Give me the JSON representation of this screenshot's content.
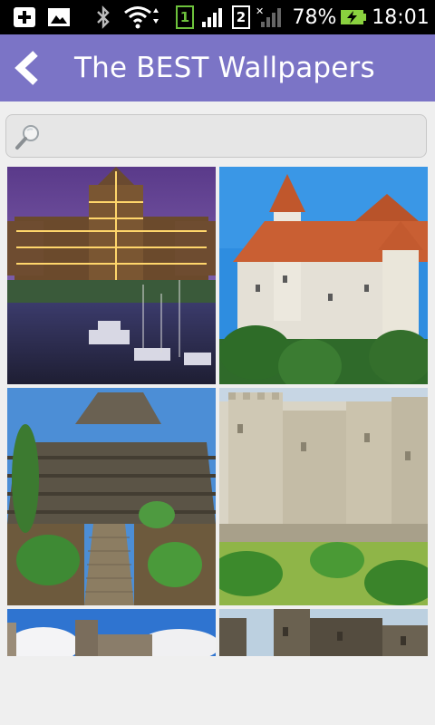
{
  "status_bar": {
    "sim1_label": "1",
    "sim2_label": "2",
    "battery_percent": "78%",
    "time": "18:01",
    "icons": [
      "add-notification-icon",
      "image-notification-icon",
      "bluetooth-icon",
      "wifi-icon",
      "signal-icon",
      "battery-charging-icon"
    ]
  },
  "app_bar": {
    "title": "The BEST Wallpapers",
    "back_icon": "back-arrow-icon",
    "color": "#7b74c6"
  },
  "search": {
    "icon": "search-icon",
    "value": "",
    "placeholder": ""
  },
  "wallpapers": [
    {
      "subject": "parliament-at-night"
    },
    {
      "subject": "white-castle-red-roofs"
    },
    {
      "subject": "stone-temple-stairs"
    },
    {
      "subject": "fortress-walls"
    },
    {
      "subject": "castle-blue-sky"
    },
    {
      "subject": "castle-towers"
    }
  ]
}
